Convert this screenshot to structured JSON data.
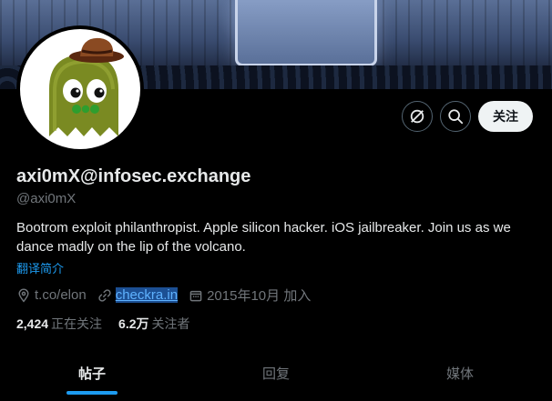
{
  "profile": {
    "display_name": "axi0mX@infosec.exchange",
    "handle": "@axi0mX",
    "bio": "Bootrom exploit philanthropist. Apple silicon hacker. iOS jailbreaker. Join us as we dance madly on the lip of the volcano.",
    "translate_label": "翻译简介",
    "location": "t.co/elon",
    "website": "checkra.in",
    "joined": "2015年10月 加入",
    "following_count": "2,424",
    "following_label": "正在关注",
    "followers_count": "6.2万",
    "followers_label": "关注者"
  },
  "actions": {
    "follow_label": "关注",
    "icons": [
      "no-signal-icon",
      "search-icon"
    ]
  },
  "tabs": [
    {
      "label": "帖子",
      "active": true
    },
    {
      "label": "回复",
      "active": false
    },
    {
      "label": "媒体",
      "active": false
    }
  ],
  "colors": {
    "accent": "#1d9bf0",
    "background": "#000000",
    "text_primary": "#e7e9ea",
    "text_secondary": "#71767b"
  }
}
